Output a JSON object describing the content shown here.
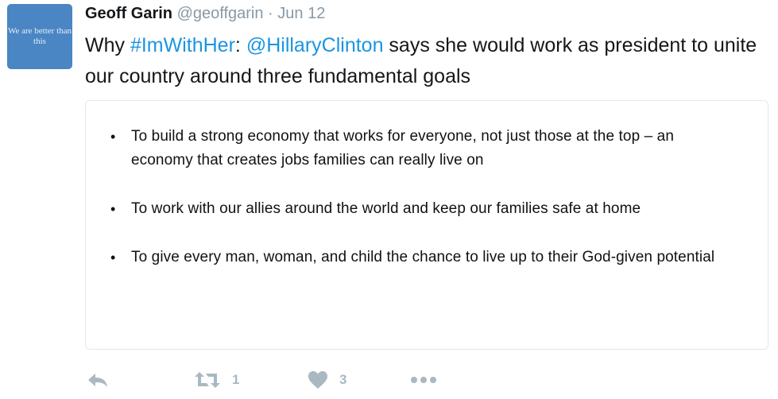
{
  "tweet": {
    "avatar_text": "We are better than this",
    "author_name": "Geoff Garin",
    "author_handle": "@geoffgarin",
    "separator": "·",
    "date": "Jun 12",
    "text": {
      "prefix": "Why ",
      "hashtag": "#ImWithHer",
      "colon": ": ",
      "mention": "@HillaryClinton",
      "rest": " says she would work as president to unite our country around three fundamental goals"
    },
    "card_items": [
      "To build a strong economy that works for everyone, not just those at the top – an economy that creates jobs families can really live on",
      "To work with our allies around the world and keep our families safe at home",
      "To give every man, woman, and child the chance to live up to their God-given potential"
    ],
    "bullet": "•",
    "actions": {
      "reply_icon": "reply-icon",
      "retweet_icon": "retweet-icon",
      "retweet_count": "1",
      "like_icon": "heart-icon",
      "like_count": "3",
      "more_icon": "more-icon"
    }
  },
  "colors": {
    "link": "#1b95e0",
    "meta": "#8899a6",
    "action": "#aab8c2",
    "avatar_bg": "#4a86c4"
  }
}
